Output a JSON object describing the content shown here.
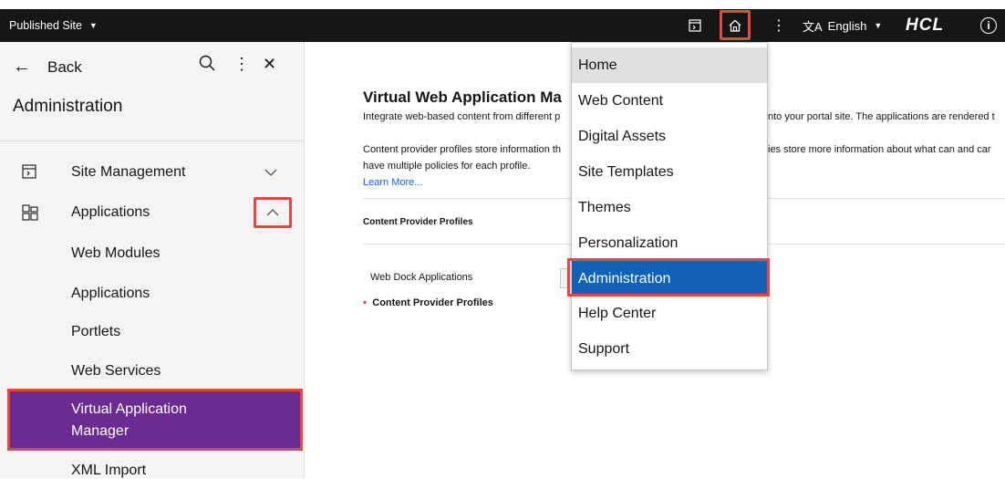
{
  "top_strip": {
    "heading_fragment": ""
  },
  "topbar": {
    "site_switch": "Published Site",
    "language": "English",
    "language_icon_glyph": "文A",
    "logo_text": "HCL",
    "icons": [
      "page-panel-icon",
      "home-icon",
      "overflow-menu-icon",
      "translate-icon",
      "info-icon"
    ]
  },
  "sidebar": {
    "back_label": "Back",
    "title": "Administration",
    "tools": [
      "search-icon",
      "overflow-menu-icon",
      "close-icon"
    ],
    "sections": [
      {
        "label": "Site Management",
        "icon": "site-management-icon",
        "expanded": false
      },
      {
        "label": "Applications",
        "icon": "applications-icon",
        "expanded": true
      }
    ],
    "sub_items": [
      "Web Modules",
      "Applications",
      "Portlets",
      "Web Services"
    ],
    "active_item": {
      "line1": "Virtual Application",
      "line2": "Manager"
    },
    "next_item": "XML Import"
  },
  "main": {
    "title": "Virtual Web Application Ma",
    "desc1_left": "Integrate web-based content from different p",
    "desc1_right": "nto your portal site. The applications are rendered t",
    "desc2_left": "Content provider profiles store information th",
    "desc2_right": "ies store more information about what can and car",
    "desc3": "have multiple policies for each profile.",
    "learn_more": "Learn More...",
    "section_label": "Content Provider Profiles",
    "app_label": "Web Dock Applications",
    "crumb": "Content Provider Profiles"
  },
  "menu": {
    "items": [
      "Home",
      "Web Content",
      "Digital Assets",
      "Site Templates",
      "Themes",
      "Personalization",
      "Administration",
      "Help Center",
      "Support"
    ],
    "highlighted": "Home",
    "selected": "Administration"
  },
  "colors": {
    "topbar_bg": "#161616",
    "sidebar_bg": "#f4f4f4",
    "active_purple": "#6a2c91",
    "menu_selected_blue": "#0f62b8",
    "highlight_red": "#e8473f",
    "link_blue": "#0f62fe"
  }
}
